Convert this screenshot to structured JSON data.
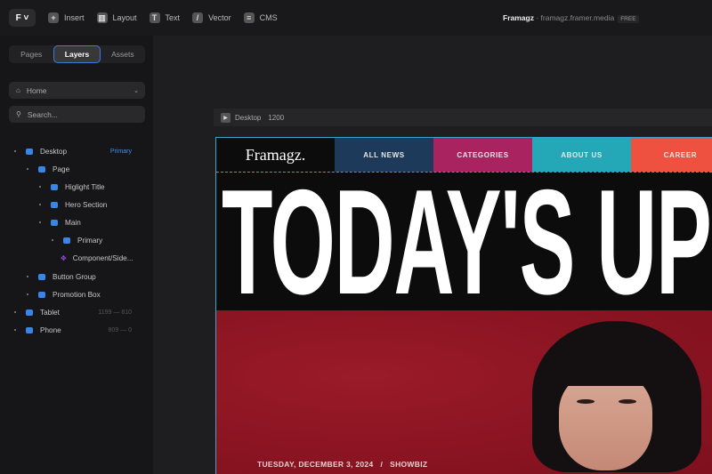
{
  "toolbar": {
    "insert": "Insert",
    "layout": "Layout",
    "text": "Text",
    "vector": "Vector",
    "cms": "CMS"
  },
  "project": {
    "name": "Framagz",
    "domain": "framagz.framer.media",
    "plan": "FREE"
  },
  "sidebar": {
    "tabs": [
      "Pages",
      "Layers",
      "Assets"
    ],
    "page": "Home",
    "search_placeholder": "Search...",
    "layers": [
      {
        "label": "Desktop",
        "hint": "Primary"
      },
      {
        "label": "Page"
      },
      {
        "label": "Higlight Title"
      },
      {
        "label": "Hero Section"
      },
      {
        "label": "Main"
      },
      {
        "label": "Primary"
      },
      {
        "label": "Component/Side..."
      },
      {
        "label": "Button Group"
      },
      {
        "label": "Promotion Box"
      },
      {
        "label": "Tablet",
        "hint": "1199 — 810"
      },
      {
        "label": "Phone",
        "hint": "809 — 0"
      }
    ]
  },
  "frame": {
    "name": "Desktop",
    "width": "1200"
  },
  "site": {
    "logo": "Framagz.",
    "nav": [
      "ALL NEWS",
      "CATEGORIES",
      "ABOUT US",
      "CAREER"
    ],
    "nav_colors": [
      "#1d3a5a",
      "#a8235f",
      "#24a8b8",
      "#ef5140"
    ],
    "headline": "TODAY'S UP",
    "date": "TUESDAY, DECEMBER 3, 2024   /   SHOWBIZ"
  }
}
